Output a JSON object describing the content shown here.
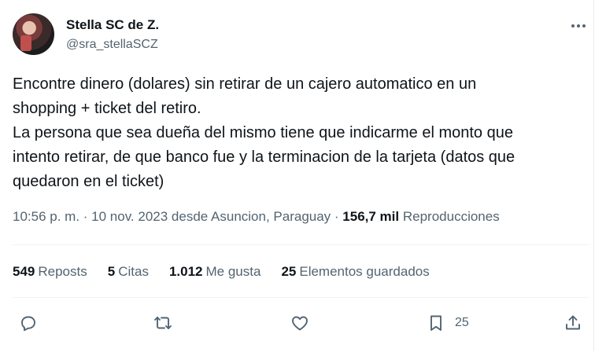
{
  "author": {
    "name": "Stella SC de Z.",
    "handle": "@sra_stellaSCZ"
  },
  "tweet": {
    "text": "Encontre dinero (dolares) sin retirar de un cajero automatico en un\nshopping + ticket del retiro.\nLa persona que sea dueña del mismo tiene que indicarme el monto que\nintento retirar, de que banco fue y la terminacion de la tarjeta (datos que\nquedaron en el ticket)"
  },
  "meta": {
    "time_date": "10:56 p. m. · 10 nov. 2023 desde Asuncion, Paraguay · ",
    "views_count": "156,7 mil",
    "views_label": "Reproducciones"
  },
  "stats": {
    "reposts_count": "549",
    "reposts_label": "Reposts",
    "quotes_count": "5",
    "quotes_label": "Citas",
    "likes_count": "1.012",
    "likes_label": "Me gusta",
    "bookmarks_count": "25",
    "bookmarks_label": "Elementos guardados"
  },
  "actions": {
    "bookmark_count": "25",
    "icons": [
      "reply-icon",
      "repost-icon",
      "like-icon",
      "bookmark-icon",
      "share-icon"
    ]
  },
  "colors": {
    "text": "#0f1419",
    "muted": "#536471",
    "divider": "#eff3f4"
  }
}
